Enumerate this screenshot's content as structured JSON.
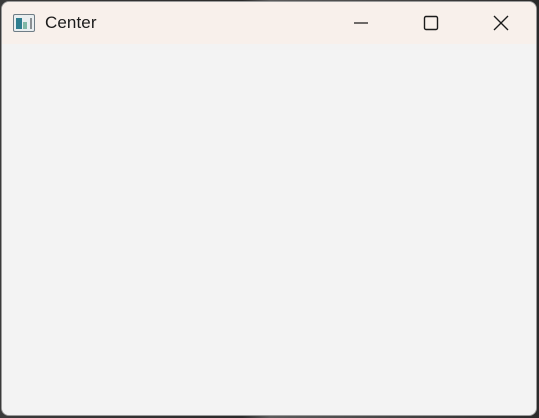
{
  "window": {
    "title": "Center",
    "controls": {
      "minimize_icon": "minimize-icon",
      "maximize_icon": "maximize-icon",
      "close_icon": "close-icon"
    }
  },
  "colors": {
    "titlebar_bg": "#f8f0eb",
    "client_bg": "#f3f3f3"
  }
}
